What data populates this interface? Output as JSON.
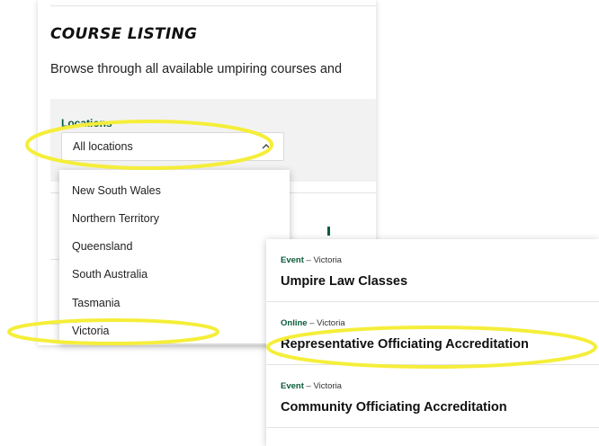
{
  "page": {
    "title": "COURSE LISTING",
    "intro": "Browse through all available umpiring courses and"
  },
  "filter": {
    "label": "Locations",
    "selected": "All locations",
    "chevron_icon": "chevron-up-icon"
  },
  "dropdown": {
    "options": [
      "New South Wales",
      "Northern Territory",
      "Queensland",
      "South Australia",
      "Tasmania",
      "Victoria"
    ]
  },
  "results": [
    {
      "type": "Event",
      "location": "Victoria",
      "title": "Umpire Law Classes"
    },
    {
      "type": "Online",
      "location": "Victoria",
      "title": "Representative Officiating Accreditation"
    },
    {
      "type": "Event",
      "location": "Victoria",
      "title": "Community Officiating Accreditation"
    }
  ],
  "colors": {
    "accent_green": "#0b5b3a",
    "highlight_yellow": "#f5ee3a",
    "panel_gray": "#f2f2f2"
  }
}
